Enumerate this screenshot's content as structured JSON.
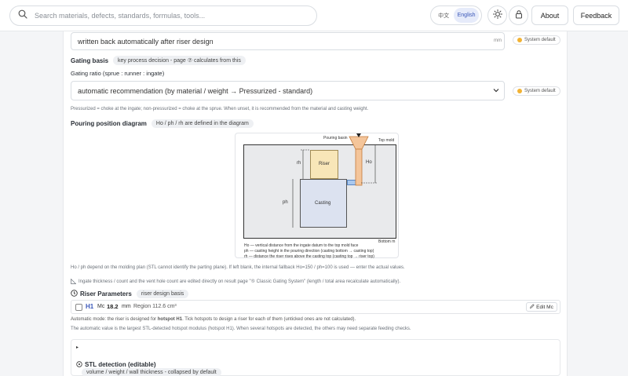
{
  "header": {
    "search_placeholder": "Search materials, defects, standards, formulas, tools...",
    "lang_zh": "中文",
    "lang_en": "English",
    "about_label": "About",
    "feedback_label": "Feedback"
  },
  "riser_value_field": {
    "text": "written back automatically after riser design",
    "unit": "mm",
    "badge": "System default"
  },
  "gating_basis": {
    "label": "Gating basis",
    "pill": "key process decision - page ⑦ calculates from this"
  },
  "gating_ratio": {
    "label": "Gating ratio (sprue : runner : ingate)",
    "selected": "automatic recommendation (by material / weight → Pressurized - standard)",
    "badge": "System default",
    "help": "Pressurized = choke at the ingate; non-pressurized = choke at the sprue. When unset, it is recommended from the material and casting weight."
  },
  "pouring_diagram": {
    "label": "Pouring position diagram",
    "pill": "Ho / ph / rh are defined in the diagram",
    "pouring_basin": "Pouring basin",
    "top_mold": "Top mold",
    "bottom_mold": "Bottom m",
    "riser": "Riser",
    "casting": "Casting",
    "rh": "rh",
    "ho": "Ho",
    "ph": "ph",
    "legend": [
      "Ho — vertical distance from the ingate datum to the top mold face",
      "ph — casting height in the pouring direction (casting bottom → casting top)",
      "rh — distance the riser rises above the casting top (casting top → riser top)"
    ]
  },
  "notes": {
    "line1": "Ho / ph depend on the molding plan (STL cannot identify the parting plane). If left blank, the internal fallback Ho=150 / ph=100 is used — enter the actual values.",
    "line2": "Ingate thickness / count and the vent hole count are edited directly on result page \"⑤ Classic Gating System\" (length / total area recalculate automatically)."
  },
  "riser_params": {
    "title": "Riser Parameters",
    "pill": "riser design basis",
    "row": {
      "id": "H1",
      "mc_label": "Mc",
      "mc_value": "18.2",
      "mc_unit": "mm",
      "region": "Region 112.6 cm³",
      "edit_label": "Edit Mc"
    },
    "auto_note": "Automatic mode: the riser is designed for",
    "auto_bold": "hotspot H1",
    "auto_rest": ". Tick hotspots to design a riser for each of them (unticked ones are not calculated).",
    "value_note": "The automatic value is the largest STL-detected hotspot modulus (hotspot H1). When several hotspots are detected, the others may need separate feeding checks."
  },
  "stl_detection": {
    "collapse_marker": "▸",
    "title": "STL detection (editable)",
    "pill": "volume / weight / wall thickness - collapsed by default"
  }
}
